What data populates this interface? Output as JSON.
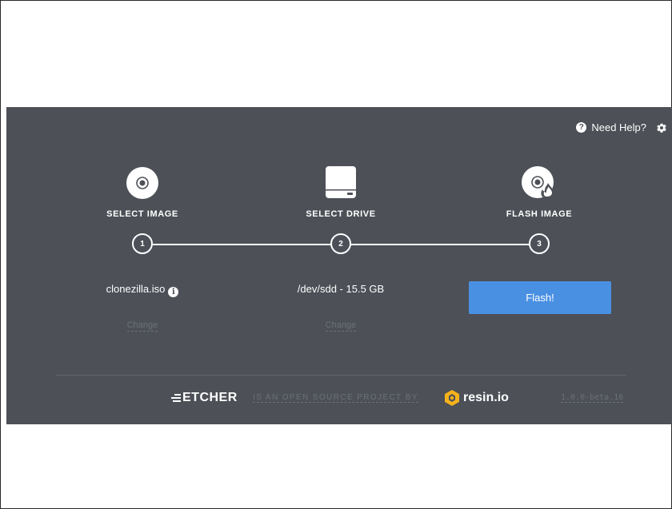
{
  "topbar": {
    "help_label": "Need Help?",
    "help_icon": "question-circle-icon",
    "settings_icon": "gear-icon"
  },
  "steps": [
    {
      "title": "SELECT IMAGE",
      "number": "1",
      "icon": "disc-icon",
      "selection": "clonezilla.iso",
      "change_label": "Change"
    },
    {
      "title": "SELECT DRIVE",
      "number": "2",
      "icon": "drive-icon",
      "selection": "/dev/sdd - 15.5 GB",
      "change_label": "Change"
    },
    {
      "title": "FLASH IMAGE",
      "number": "3",
      "icon": "flash-disc-icon",
      "button_label": "Flash!"
    }
  ],
  "footer": {
    "logo_text": "ETCHER",
    "tagline": "IS AN OPEN SOURCE PROJECT BY",
    "company": "resin.io",
    "version": "1.0.0-beta.16"
  },
  "colors": {
    "background": "#4d5057",
    "accent": "#4a90e2",
    "muted": "#6c7078"
  }
}
